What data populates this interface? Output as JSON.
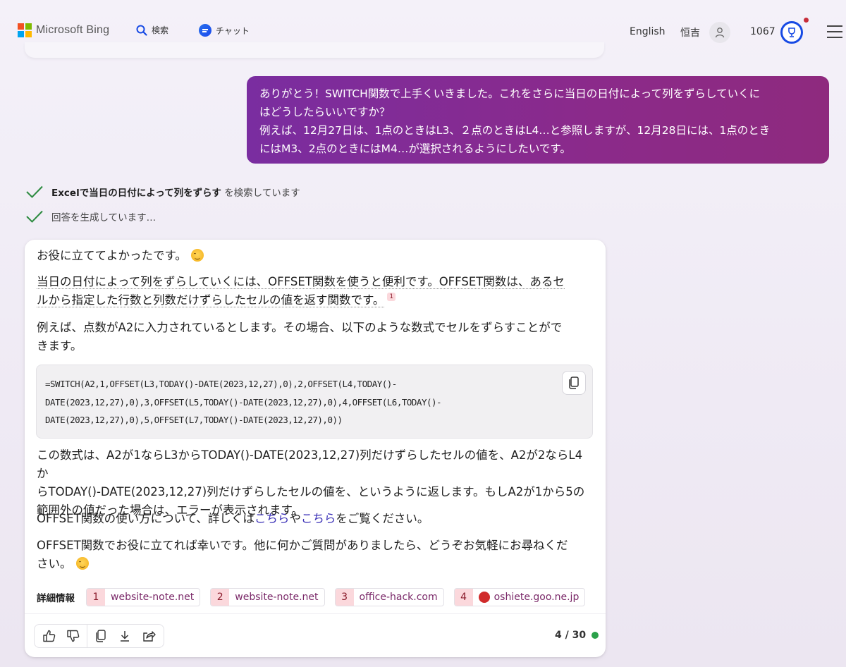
{
  "header": {
    "brand": "Microsoft Bing",
    "nav_search": "検索",
    "nav_chat": "チャット",
    "language": "English",
    "user_name": "恒吉",
    "points": "1067",
    "logo_colors": [
      "#f25022",
      "#7fba00",
      "#00a4ef",
      "#ffb900"
    ]
  },
  "user_message": {
    "line1": "ありがとう！SWITCH関数で上手くいきました。これをさらに当日の日付によって列をずらしていくに",
    "line2": "はどうしたらいいですか？",
    "line3": "例えば、12月27日は、1点のときはL3、２点のときはL4…と参照しますが、12月28日には、1点のとき",
    "line4": "にはM3、2点のときにはM4…が選択されるようにしたいです。"
  },
  "status": {
    "search_query": "Excelで当日の日付によって列をずらす",
    "search_suffix": " を検索しています",
    "generating": "回答を生成しています…"
  },
  "response": {
    "p1": "お役に立ててよかったです。",
    "p2_line1": "当日の日付によって列をずらしていくには、OFFSET関数を使うと便利です。OFFSET関数は、あるセ",
    "p2_line2": "ルから指定した行数と列数だけずらしたセルの値を返す関数です。",
    "p2_cite": "1",
    "p3_line1": "例えば、点数がA2に入力されているとします。その場合、以下のような数式でセルをずらすことがで",
    "p3_line2": "きます。",
    "code_line1": "=SWITCH(A2,1,OFFSET(L3,TODAY()-DATE(2023,12,27),0),2,OFFSET(L4,TODAY()-",
    "code_line2": "DATE(2023,12,27),0),3,OFFSET(L5,TODAY()-DATE(2023,12,27),0),4,OFFSET(L6,TODAY()-",
    "code_line3": "DATE(2023,12,27),0),5,OFFSET(L7,TODAY()-DATE(2023,12,27),0))",
    "p4_line1": "この数式は、A2が1ならL3からTODAY()-DATE(2023,12,27)列だけずらしたセルの値を、A2が2ならL4か",
    "p4_line2": "らTODAY()-DATE(2023,12,27)列だけずらしたセルの値を、というように返します。もしA2が1から5の",
    "p4_line3": "範囲外の値だった場合は、エラーが表示されます。",
    "p5_before": "OFFSET関数の使い方について、詳しくは",
    "p5_link1": "こちら",
    "p5_mid": "や",
    "p5_link2": "こちら",
    "p5_after": "をご覧ください。",
    "p6_line1": "OFFSET関数でお役に立てれば幸いです。他に何かご質問がありましたら、どうぞお気軽にお尋ねくだ",
    "p6_line2": "さい。"
  },
  "sources": {
    "label": "詳細情報",
    "items": [
      {
        "num": "1",
        "domain": "website-note.net"
      },
      {
        "num": "2",
        "domain": "website-note.net"
      },
      {
        "num": "3",
        "domain": "office-hack.com"
      },
      {
        "num": "4",
        "domain": "oshiete.goo.ne.jp"
      }
    ]
  },
  "footer": {
    "count": "4 / 30",
    "status_color": "#2ba14a"
  }
}
